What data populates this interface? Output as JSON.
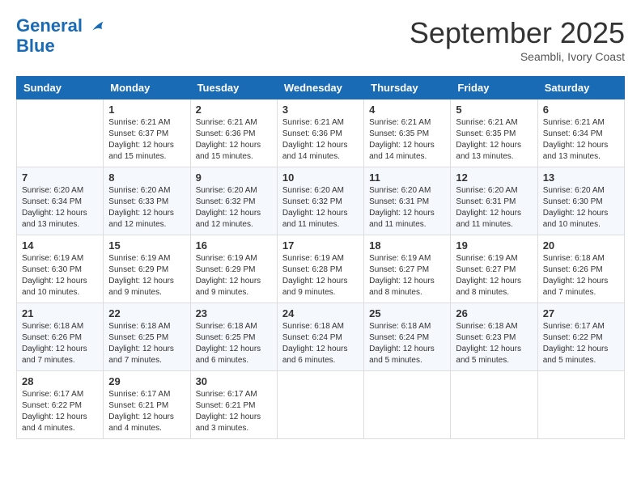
{
  "header": {
    "logo_line1": "General",
    "logo_line2": "Blue",
    "month_title": "September 2025",
    "subtitle": "Seambli, Ivory Coast"
  },
  "days_of_week": [
    "Sunday",
    "Monday",
    "Tuesday",
    "Wednesday",
    "Thursday",
    "Friday",
    "Saturday"
  ],
  "weeks": [
    [
      {
        "day": "",
        "info": ""
      },
      {
        "day": "1",
        "info": "Sunrise: 6:21 AM\nSunset: 6:37 PM\nDaylight: 12 hours\nand 15 minutes."
      },
      {
        "day": "2",
        "info": "Sunrise: 6:21 AM\nSunset: 6:36 PM\nDaylight: 12 hours\nand 15 minutes."
      },
      {
        "day": "3",
        "info": "Sunrise: 6:21 AM\nSunset: 6:36 PM\nDaylight: 12 hours\nand 14 minutes."
      },
      {
        "day": "4",
        "info": "Sunrise: 6:21 AM\nSunset: 6:35 PM\nDaylight: 12 hours\nand 14 minutes."
      },
      {
        "day": "5",
        "info": "Sunrise: 6:21 AM\nSunset: 6:35 PM\nDaylight: 12 hours\nand 13 minutes."
      },
      {
        "day": "6",
        "info": "Sunrise: 6:21 AM\nSunset: 6:34 PM\nDaylight: 12 hours\nand 13 minutes."
      }
    ],
    [
      {
        "day": "7",
        "info": "Sunrise: 6:20 AM\nSunset: 6:34 PM\nDaylight: 12 hours\nand 13 minutes."
      },
      {
        "day": "8",
        "info": "Sunrise: 6:20 AM\nSunset: 6:33 PM\nDaylight: 12 hours\nand 12 minutes."
      },
      {
        "day": "9",
        "info": "Sunrise: 6:20 AM\nSunset: 6:32 PM\nDaylight: 12 hours\nand 12 minutes."
      },
      {
        "day": "10",
        "info": "Sunrise: 6:20 AM\nSunset: 6:32 PM\nDaylight: 12 hours\nand 11 minutes."
      },
      {
        "day": "11",
        "info": "Sunrise: 6:20 AM\nSunset: 6:31 PM\nDaylight: 12 hours\nand 11 minutes."
      },
      {
        "day": "12",
        "info": "Sunrise: 6:20 AM\nSunset: 6:31 PM\nDaylight: 12 hours\nand 11 minutes."
      },
      {
        "day": "13",
        "info": "Sunrise: 6:20 AM\nSunset: 6:30 PM\nDaylight: 12 hours\nand 10 minutes."
      }
    ],
    [
      {
        "day": "14",
        "info": "Sunrise: 6:19 AM\nSunset: 6:30 PM\nDaylight: 12 hours\nand 10 minutes."
      },
      {
        "day": "15",
        "info": "Sunrise: 6:19 AM\nSunset: 6:29 PM\nDaylight: 12 hours\nand 9 minutes."
      },
      {
        "day": "16",
        "info": "Sunrise: 6:19 AM\nSunset: 6:29 PM\nDaylight: 12 hours\nand 9 minutes."
      },
      {
        "day": "17",
        "info": "Sunrise: 6:19 AM\nSunset: 6:28 PM\nDaylight: 12 hours\nand 9 minutes."
      },
      {
        "day": "18",
        "info": "Sunrise: 6:19 AM\nSunset: 6:27 PM\nDaylight: 12 hours\nand 8 minutes."
      },
      {
        "day": "19",
        "info": "Sunrise: 6:19 AM\nSunset: 6:27 PM\nDaylight: 12 hours\nand 8 minutes."
      },
      {
        "day": "20",
        "info": "Sunrise: 6:18 AM\nSunset: 6:26 PM\nDaylight: 12 hours\nand 7 minutes."
      }
    ],
    [
      {
        "day": "21",
        "info": "Sunrise: 6:18 AM\nSunset: 6:26 PM\nDaylight: 12 hours\nand 7 minutes."
      },
      {
        "day": "22",
        "info": "Sunrise: 6:18 AM\nSunset: 6:25 PM\nDaylight: 12 hours\nand 7 minutes."
      },
      {
        "day": "23",
        "info": "Sunrise: 6:18 AM\nSunset: 6:25 PM\nDaylight: 12 hours\nand 6 minutes."
      },
      {
        "day": "24",
        "info": "Sunrise: 6:18 AM\nSunset: 6:24 PM\nDaylight: 12 hours\nand 6 minutes."
      },
      {
        "day": "25",
        "info": "Sunrise: 6:18 AM\nSunset: 6:24 PM\nDaylight: 12 hours\nand 5 minutes."
      },
      {
        "day": "26",
        "info": "Sunrise: 6:18 AM\nSunset: 6:23 PM\nDaylight: 12 hours\nand 5 minutes."
      },
      {
        "day": "27",
        "info": "Sunrise: 6:17 AM\nSunset: 6:22 PM\nDaylight: 12 hours\nand 5 minutes."
      }
    ],
    [
      {
        "day": "28",
        "info": "Sunrise: 6:17 AM\nSunset: 6:22 PM\nDaylight: 12 hours\nand 4 minutes."
      },
      {
        "day": "29",
        "info": "Sunrise: 6:17 AM\nSunset: 6:21 PM\nDaylight: 12 hours\nand 4 minutes."
      },
      {
        "day": "30",
        "info": "Sunrise: 6:17 AM\nSunset: 6:21 PM\nDaylight: 12 hours\nand 3 minutes."
      },
      {
        "day": "",
        "info": ""
      },
      {
        "day": "",
        "info": ""
      },
      {
        "day": "",
        "info": ""
      },
      {
        "day": "",
        "info": ""
      }
    ]
  ]
}
